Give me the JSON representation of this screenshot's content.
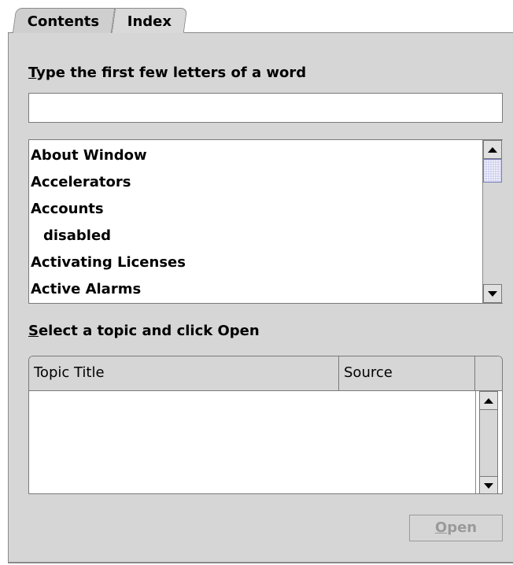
{
  "tabs": [
    {
      "label": "Contents",
      "selected": false
    },
    {
      "label": "Index",
      "selected": true
    }
  ],
  "search": {
    "label_mnemonic": "T",
    "label_rest": "ype the first few letters of a word",
    "value": "",
    "placeholder": ""
  },
  "index_list": {
    "items": [
      {
        "label": "About Window",
        "indent": 0
      },
      {
        "label": "Accelerators",
        "indent": 0
      },
      {
        "label": "Accounts",
        "indent": 0
      },
      {
        "label": "disabled",
        "indent": 1
      },
      {
        "label": "Activating Licenses",
        "indent": 0
      },
      {
        "label": "Active Alarms",
        "indent": 0
      }
    ]
  },
  "topics": {
    "label_mnemonic": "S",
    "label_rest": "elect a topic and click Open",
    "columns": [
      "Topic Title",
      "Source"
    ],
    "rows": []
  },
  "open_button": {
    "mnemonic": "O",
    "rest": "pen",
    "enabled": false
  },
  "colors": {
    "panel": "#d6d6d6",
    "thumb": "#c7c8ec",
    "disabled_text": "#9a9a9a"
  }
}
